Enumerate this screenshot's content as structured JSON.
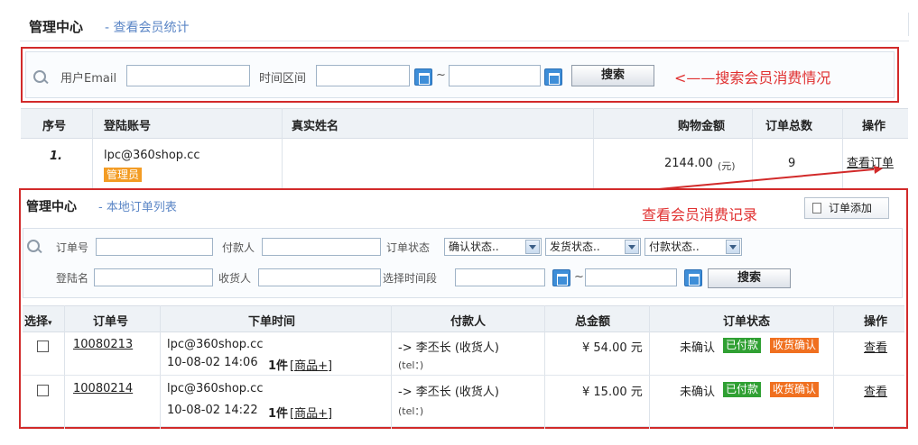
{
  "top": {
    "title": "管理中心",
    "subtitle": "- 查看会员统计",
    "search": {
      "email_label": "用户Email",
      "date_label": "时间区间",
      "tilde": "~",
      "button": "搜索"
    },
    "annotation": "<——搜索会员消费情况"
  },
  "member_table": {
    "headers": [
      "序号",
      "登陆账号",
      "真实姓名",
      "购物金额",
      "订单总数",
      "操作"
    ],
    "row": {
      "index": "1.",
      "account": "lpc@360shop.cc",
      "badge": "管理员",
      "amount": "2144.00",
      "amount_unit": "(元)",
      "orders": "9",
      "action": "查看订单"
    }
  },
  "orders": {
    "title": "管理中心",
    "subtitle": "- 本地订单列表",
    "annotation": "查看会员消费记录",
    "add_button": "订单添加",
    "search": {
      "order_no": "订单号",
      "payer": "付款人",
      "status": "订单状态",
      "confirm_sel": "确认状态..",
      "ship_sel": "发货状态..",
      "pay_sel": "付款状态..",
      "login": "登陆名",
      "receiver": "收货人",
      "time_range": "选择时间段",
      "tilde": "~",
      "button": "搜索"
    },
    "headers": [
      "选择",
      "订单号",
      "下单时间",
      "付款人",
      "总金额",
      "订单状态",
      "操作"
    ],
    "rows": [
      {
        "order_no": "10080213",
        "user": "lpc@360shop.cc",
        "time": "10-08-02 14:06",
        "qty": "1件",
        "goods": "[商品+]",
        "payer": "-> 李丕长 (收货人)",
        "tel": "(tel：)",
        "total": "¥ 54.00 元",
        "status": "未确认",
        "paid": "已付款",
        "receipt": "收货确认",
        "action": "查看"
      },
      {
        "order_no": "10080214",
        "user": "lpc@360shop.cc",
        "time": "10-08-02 14:22",
        "qty": "1件",
        "goods": "[商品+]",
        "payer": "-> 李丕长 (收货人)",
        "tel": "(tel：)",
        "total": "¥ 15.00 元",
        "status": "未确认",
        "paid": "已付款",
        "receipt": "收货确认",
        "action": "查看"
      }
    ]
  },
  "colors": {
    "annotation_red": "#e03030",
    "accent_blue": "#5b86c6",
    "paid_green": "#30a033",
    "receipt_orange": "#f07020",
    "admin_orange": "#f39c24"
  }
}
